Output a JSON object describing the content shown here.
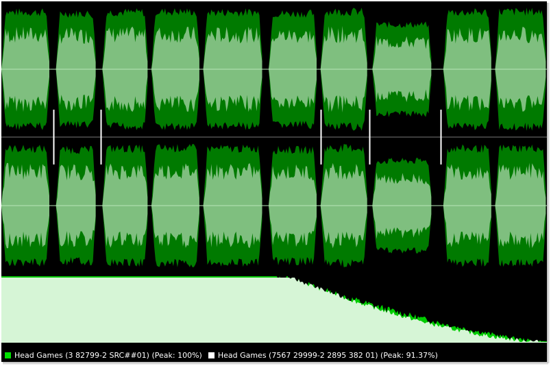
{
  "legend": [
    {
      "label": "Head Games (3 82799-2 SRC##01) (Peak: 100%)",
      "color": "#00e000"
    },
    {
      "label": "Head Games (7567 29999-2 2895 382 01) (Peak: 91.37%)",
      "color": "#ffffff"
    }
  ],
  "colors": {
    "background": "#000000",
    "series_dark": "#007a00",
    "series_light": "#7fbf7f",
    "spectrum_light": "#d6f5d6",
    "spectrum_green": "#00cc00",
    "track_marker": "#ffffff"
  },
  "chart_data": {
    "type": "area",
    "tracks": [
      {
        "start": 0.0,
        "end": 0.09,
        "level": 0.92
      },
      {
        "start": 0.1,
        "end": 0.175,
        "level": 0.9
      },
      {
        "start": 0.185,
        "end": 0.27,
        "level": 0.92
      },
      {
        "start": 0.275,
        "end": 0.365,
        "level": 0.93
      },
      {
        "start": 0.37,
        "end": 0.48,
        "level": 0.92
      },
      {
        "start": 0.49,
        "end": 0.58,
        "level": 0.9
      },
      {
        "start": 0.585,
        "end": 0.672,
        "level": 0.93
      },
      {
        "start": 0.68,
        "end": 0.79,
        "level": 0.72
      },
      {
        "start": 0.81,
        "end": 0.9,
        "level": 0.92
      },
      {
        "start": 0.905,
        "end": 1.0,
        "level": 0.93
      }
    ],
    "markers": [
      0.095,
      0.182,
      0.585,
      0.675,
      0.805
    ]
  }
}
